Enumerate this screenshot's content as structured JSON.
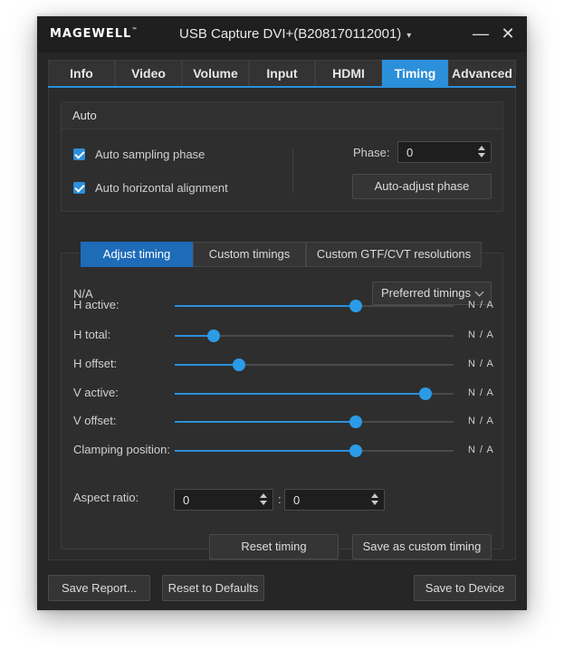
{
  "window": {
    "brand": "MAGEWELL",
    "brand_mark": "™",
    "title": "USB Capture DVI+(B208170112001)",
    "title_caret": "▾",
    "minimize": "—",
    "close": "✕"
  },
  "tabs": [
    {
      "label": "Info"
    },
    {
      "label": "Video"
    },
    {
      "label": "Volume"
    },
    {
      "label": "Input"
    },
    {
      "label": "HDMI"
    },
    {
      "label": "Timing",
      "active": true
    },
    {
      "label": "Advanced"
    }
  ],
  "auto": {
    "title": "Auto",
    "auto_sampling_phase": {
      "label": "Auto sampling phase",
      "checked": true
    },
    "auto_horizontal_alignment": {
      "label": "Auto horizontal alignment",
      "checked": true
    },
    "phase_label": "Phase:",
    "phase_value": "0",
    "auto_adjust_label": "Auto-adjust phase"
  },
  "subtabs": [
    {
      "label": "Adjust timing",
      "active": true
    },
    {
      "label": "Custom timings"
    },
    {
      "label": "Custom GTF/CVT resolutions"
    }
  ],
  "timing": {
    "status": "N/A",
    "preset_dropdown": "Preferred timings",
    "sliders": [
      {
        "label": "H active:",
        "value": "N / A",
        "position": 0.65
      },
      {
        "label": "H total:",
        "value": "N / A",
        "position": 0.14
      },
      {
        "label": "H offset:",
        "value": "N / A",
        "position": 0.23
      },
      {
        "label": "V active:",
        "value": "N / A",
        "position": 0.9
      },
      {
        "label": "V offset:",
        "value": "N / A",
        "position": 0.65
      },
      {
        "label": "Clamping position:",
        "value": "N / A",
        "position": 0.65
      }
    ],
    "aspect_label": "Aspect ratio:",
    "aspect_w": "0",
    "aspect_sep": ":",
    "aspect_h": "0",
    "reset_timing_label": "Reset timing",
    "save_custom_label": "Save as custom timing"
  },
  "footer": {
    "save_report": "Save Report...",
    "reset_defaults": "Reset to Defaults",
    "save_device": "Save to Device"
  },
  "colors": {
    "accent": "#2b8fd9",
    "active_subtab": "#1e6bb8",
    "background": "#262626"
  }
}
